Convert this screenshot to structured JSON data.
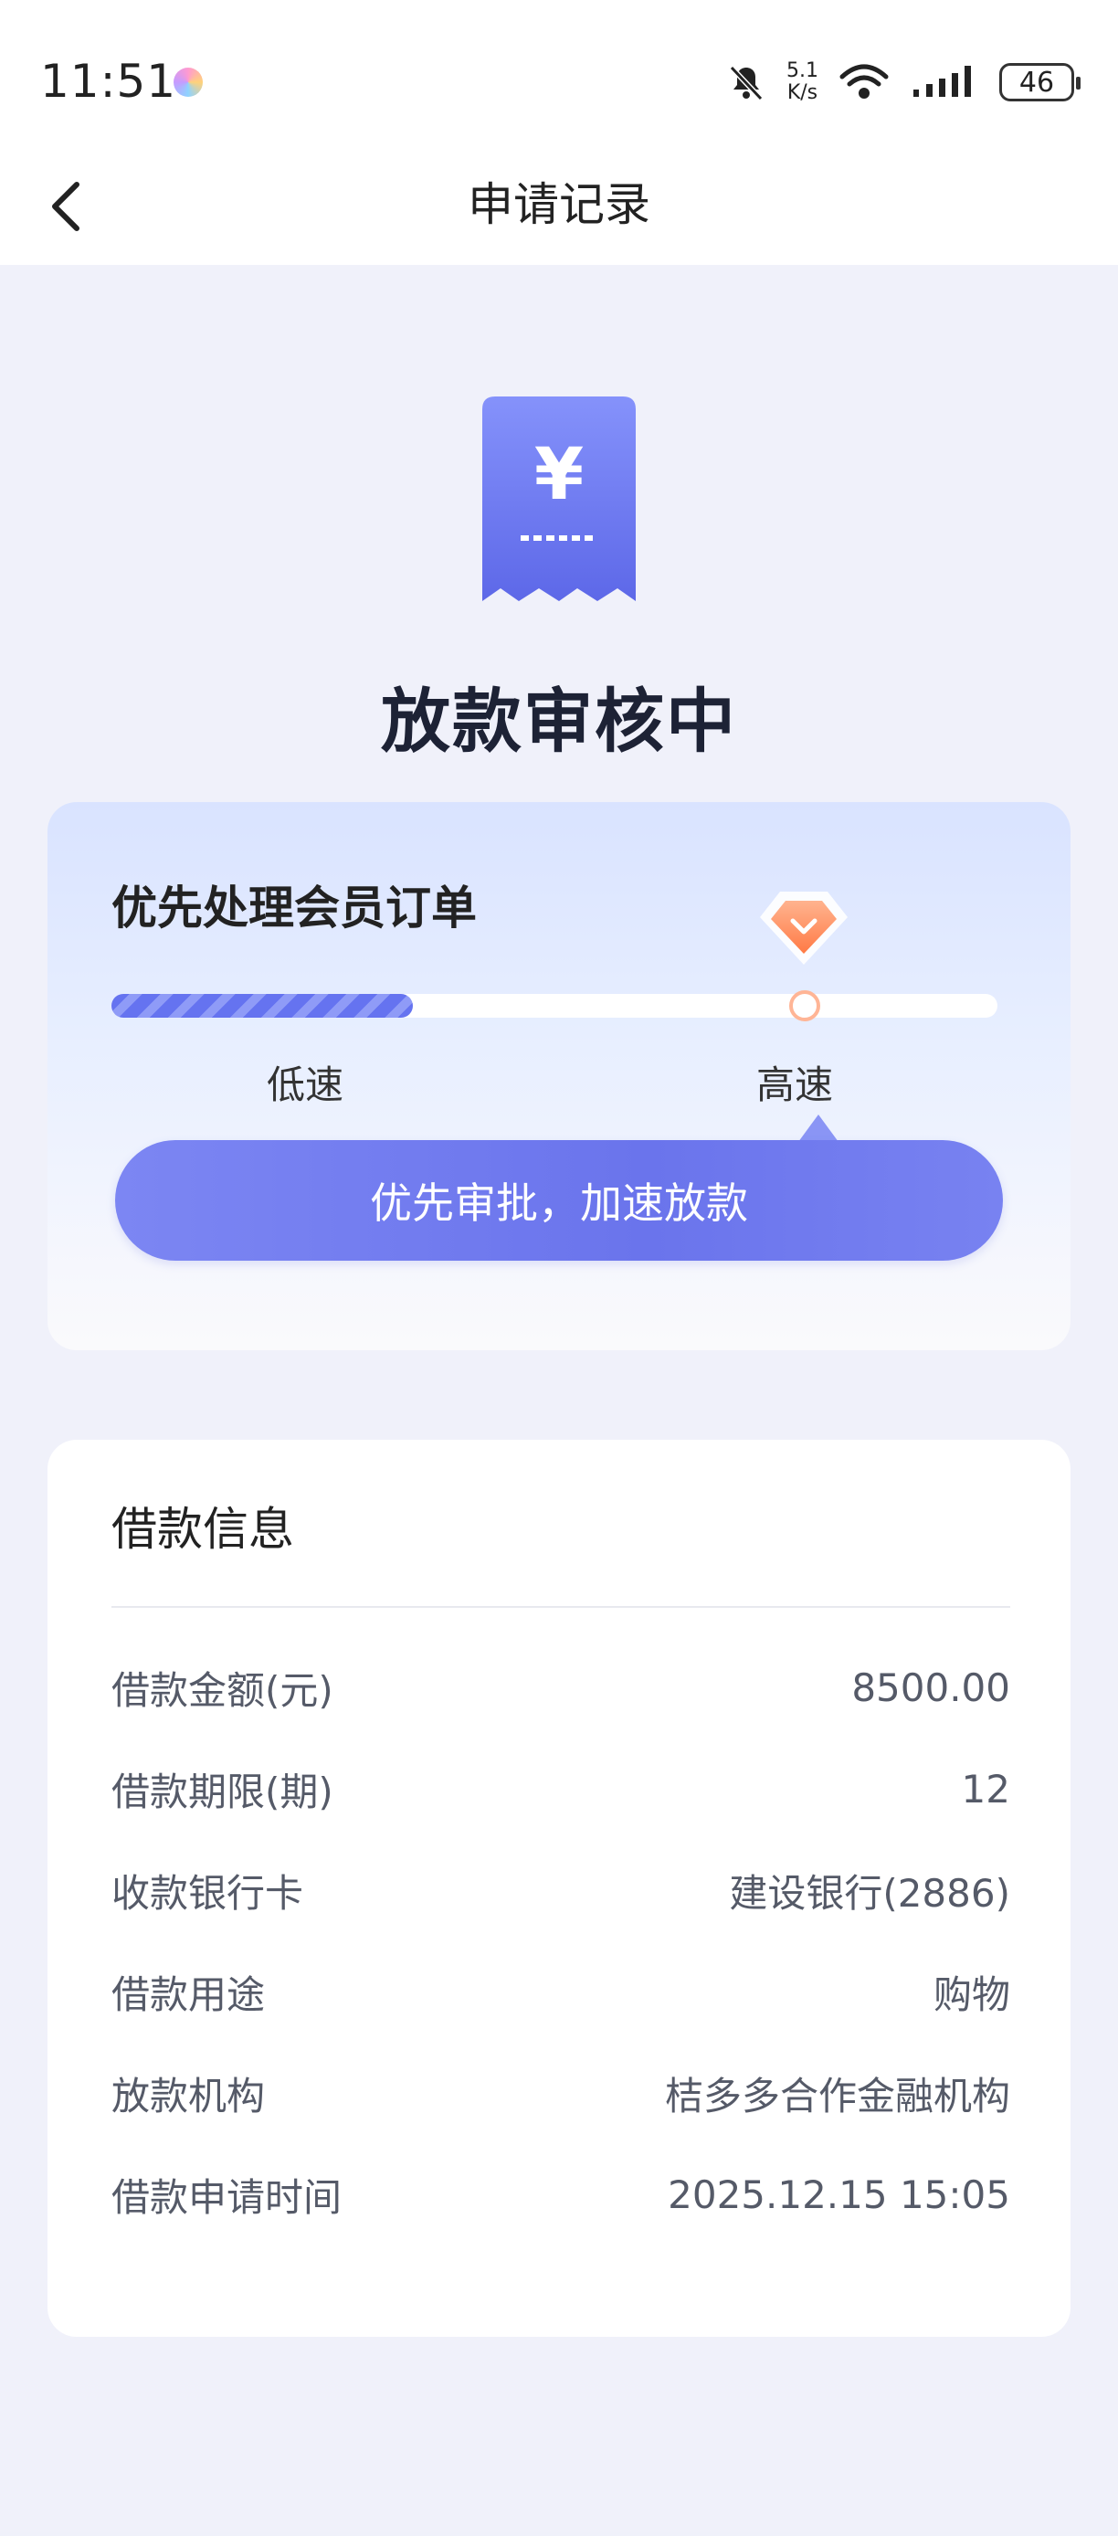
{
  "status_bar": {
    "time": "11:51",
    "net_speed_value": "5.1",
    "net_speed_unit": "K/s",
    "battery": "46"
  },
  "nav": {
    "title": "申请记录"
  },
  "status": {
    "title": "放款审核中",
    "icon_symbol": "¥"
  },
  "vip": {
    "title": "优先处理会员订单",
    "low_label": "低速",
    "high_label": "高速",
    "progress": 0.34,
    "cta_label": "优先审批，加速放款"
  },
  "loan_info": {
    "title": "借款信息",
    "rows": [
      {
        "label": "借款金额(元)",
        "value": "8500.00"
      },
      {
        "label": "借款期限(期)",
        "value": "12"
      },
      {
        "label": "收款银行卡",
        "value": "建设银行(2886)"
      },
      {
        "label": "借款用途",
        "value": "购物"
      },
      {
        "label": "放款机构",
        "value": "桔多多合作金融机构"
      },
      {
        "label": "借款申请时间",
        "value": "2025.12.15 15:05"
      }
    ]
  },
  "colors": {
    "accent": "#6a74ec",
    "background": "#f0f1fa",
    "highlight": "#ff8a5c"
  }
}
